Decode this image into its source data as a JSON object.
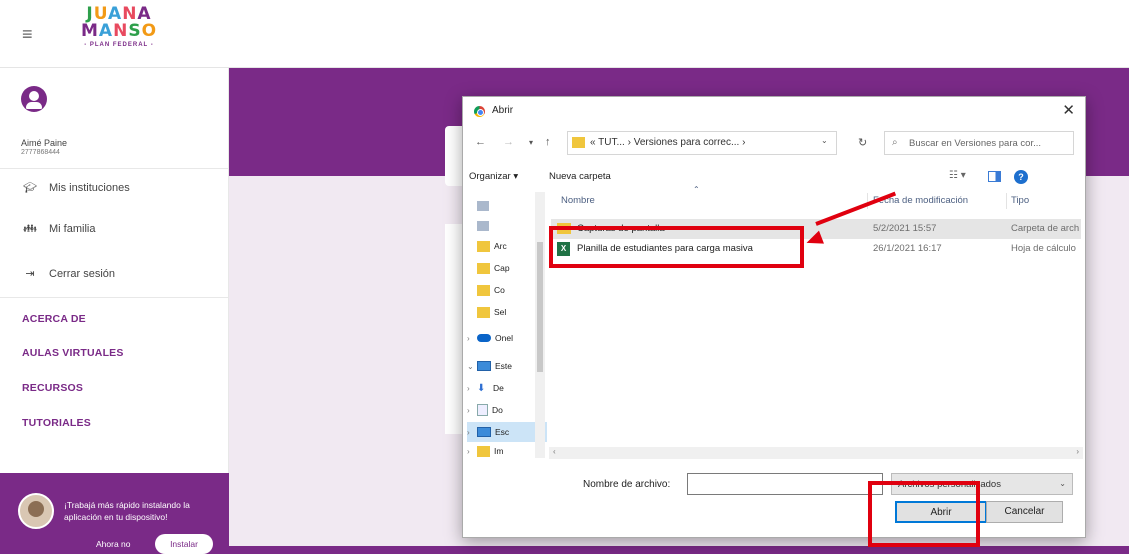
{
  "app": {
    "logo": {
      "line1": "JUANA",
      "line2": "MANSO",
      "tagline": "- PLAN FEDERAL -"
    },
    "user": {
      "name": "Aimé Paine",
      "id": "2777868444"
    },
    "nav": [
      {
        "label": "Mis instituciones",
        "icon": "graduation-cap-icon"
      },
      {
        "label": "Mi familia",
        "icon": "family-icon"
      },
      {
        "label": "Cerrar sesión",
        "icon": "logout-icon"
      }
    ],
    "sections": [
      "ACERCA DE",
      "AULAS VIRTUALES",
      "RECURSOS",
      "TUTORIALES"
    ],
    "promo": {
      "text": "¡Trabajá más rápido instalando la aplicación en tu dispositivo!",
      "later_label": "Ahora no",
      "install_label": "Instalar"
    }
  },
  "dialog": {
    "title": "Abrir",
    "close": "✕",
    "nav": {
      "back": "←",
      "forward": "→",
      "recent": "▾",
      "up": "↑"
    },
    "address": "« TUT... › Versiones para correc... ›",
    "refresh": "↻",
    "search_placeholder": "Buscar en Versiones para cor...",
    "toolbar": {
      "organize": "Organizar ▾",
      "new_folder": "Nueva carpeta",
      "help": "?",
      "view": "☷ ▾"
    },
    "nav_pane": [
      {
        "label": "",
        "kind": "pin"
      },
      {
        "label": "",
        "kind": "pin"
      },
      {
        "label": "Arc",
        "kind": "folder"
      },
      {
        "label": "Cap",
        "kind": "folder"
      },
      {
        "label": "Co",
        "kind": "folder"
      },
      {
        "label": "Sel",
        "kind": "folder"
      },
      {
        "label": "Onel",
        "kind": "cloud",
        "chev": "›"
      },
      {
        "label": "Este",
        "kind": "pc",
        "chev": "⌄"
      },
      {
        "label": "De",
        "kind": "download",
        "chev": "›"
      },
      {
        "label": "Do",
        "kind": "doc",
        "chev": "›"
      },
      {
        "label": "Esc",
        "kind": "pc",
        "chev": "›"
      },
      {
        "label": "Im",
        "kind": "folder",
        "chev": "›"
      }
    ],
    "columns": [
      "Nombre",
      "Fecha de modificación",
      "Tipo"
    ],
    "files": [
      {
        "name": "Capturas de pantalla",
        "date": "5/2/2021 15:57",
        "type": "Carpeta de arch",
        "kind": "folder"
      },
      {
        "name": "Planilla de estudiantes para carga masiva",
        "date": "26/1/2021 16:17",
        "type": "Hoja de cálculo",
        "kind": "excel"
      }
    ],
    "filename_label": "Nombre de archivo:",
    "filename_value": "",
    "filetype": "Archivos personalizados",
    "open_label": "Abrir",
    "cancel_label": "Cancelar"
  },
  "colors": {
    "brand_purple": "#7a2a87",
    "annotation_red": "#e0000f"
  }
}
